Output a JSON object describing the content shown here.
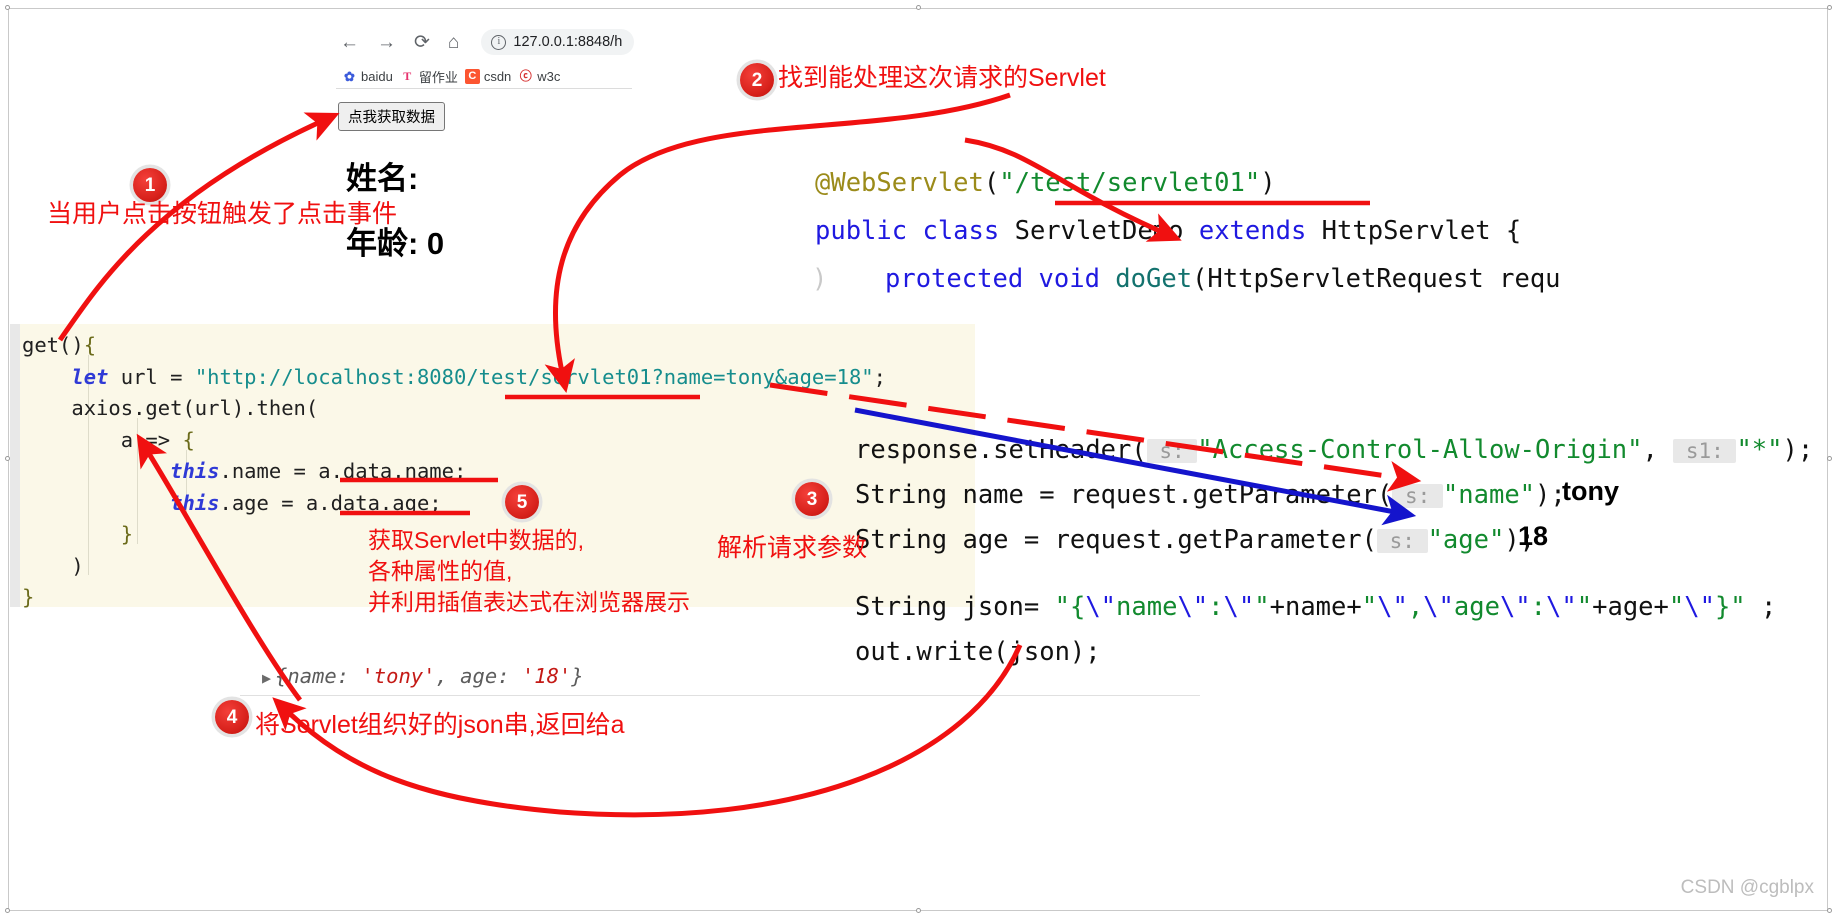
{
  "browser": {
    "nav": {
      "back_icon": "arrow-left-icon",
      "forward_icon": "arrow-right-icon",
      "reload_icon": "reload-icon",
      "home_icon": "home-icon",
      "info_icon": "info-circle-icon",
      "url": "127.0.0.1:8848/h"
    },
    "bookmarks": [
      {
        "icon": "baidu-icon",
        "glyph": "✿",
        "label": "baidu"
      },
      {
        "icon": "tmall-icon",
        "glyph": "T",
        "label": "留作业"
      },
      {
        "icon": "csdn-icon",
        "glyph": "C",
        "label": "csdn"
      },
      {
        "icon": "w3c-icon",
        "glyph": "ⓢ",
        "label": "w3c"
      }
    ],
    "page": {
      "button_label": "点我获取数据",
      "name_line": "姓名:",
      "age_line": "年龄: 0"
    }
  },
  "js_code": {
    "lines": [
      "get(){",
      "    let url = \"http://localhost:8080/test/servlet01?name=tony&age=18\";",
      "    axios.get(url).then(",
      "        a => {",
      "            this.name = a.data.name;",
      "            this.age = a.data.age;",
      "        }",
      "    )",
      "}"
    ]
  },
  "java_code": {
    "lines": [
      "@WebServlet(\"/test/servlet01\")",
      "public class ServletDemo extends HttpServlet {",
      "    protected void doGet(HttpServletRequest requ",
      "response.setHeader( s: \"Access-Control-Allow-Origin\", s1: \"*\");",
      "String name = request.getParameter( s: \"name\");",
      "String age = request.getParameter( s: \"age\");",
      "String json= \"{\\\"name\\\":\\\"\"+name+\"\\\",\\\"age\\\":\\\"\"+age+\"\\\"}\" ;",
      "out.write(json);"
    ],
    "param_hints": {
      "s": "s:",
      "s1": "s1:"
    },
    "inline_values": {
      "name": "tony",
      "age": "18"
    }
  },
  "console": {
    "expand_icon": "triangle-right-icon",
    "text_prefix": "{name: ",
    "name_value": "'tony'",
    "text_middle": ", age: ",
    "age_value": "'18'",
    "text_suffix": "}"
  },
  "annotations": [
    {
      "number": "1",
      "text": "当用户点击按钮触发了点击事件"
    },
    {
      "number": "2",
      "text": "找到能处理这次请求的Servlet"
    },
    {
      "number": "3",
      "text": "解析请求参数"
    },
    {
      "number": "4",
      "text": "将Servlet组织好的json串,返回给a"
    },
    {
      "number": "5",
      "text": "获取Servlet中数据的,\n各种属性的值,\n并利用插值表达式在浏览器展示"
    }
  ],
  "watermark": "CSDN @cgblpx",
  "colors": {
    "annotation_red": "#f01010",
    "badge_red": "#d8221c",
    "java_keyword": "#1f19e0",
    "java_string": "#128a2e",
    "java_annotation": "#9b8b1a",
    "java_method": "#13726e",
    "js_keyword": "#2f3ad6",
    "js_string": "#168d8d",
    "js_panel_bg": "#fbf8e8",
    "arrow_blue": "#1414cc",
    "watermark_gray": "#bdbdbd"
  }
}
